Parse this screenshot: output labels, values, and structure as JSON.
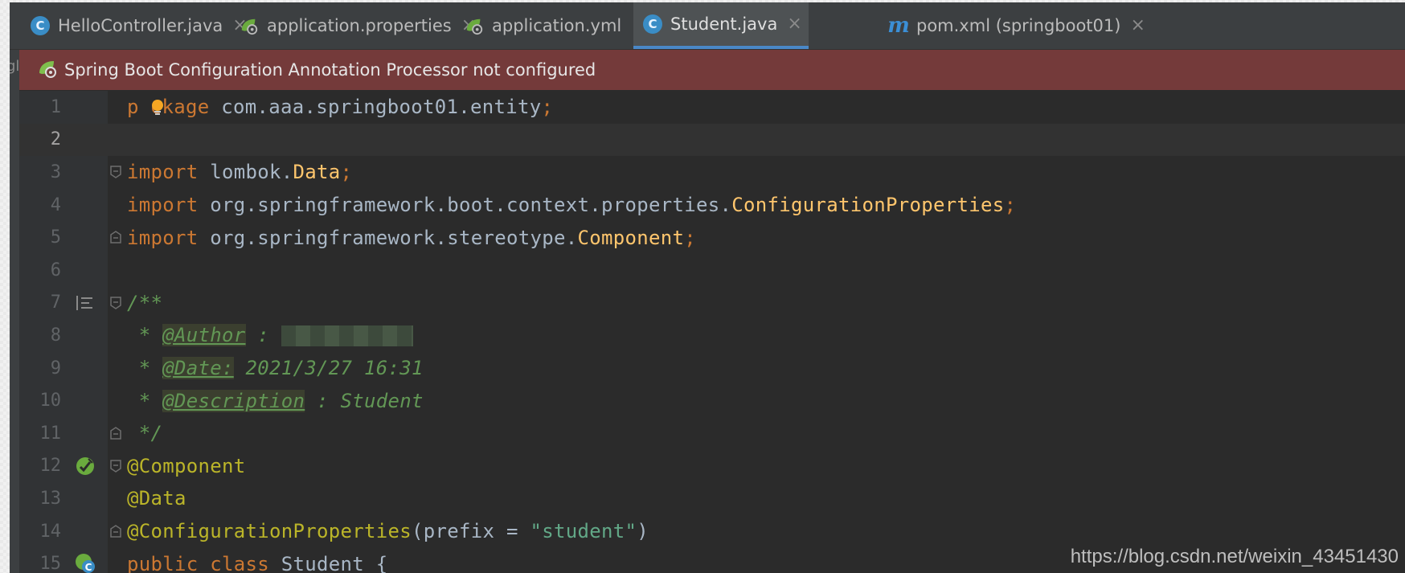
{
  "tabs": [
    {
      "label": "HelloController.java",
      "icon": "java-class-icon",
      "active": false
    },
    {
      "label": "application.properties",
      "icon": "spring-config-icon",
      "active": false
    },
    {
      "label": "application.yml",
      "icon": "spring-config-icon",
      "active": false
    },
    {
      "label": "Student.java",
      "icon": "java-class-icon",
      "active": true
    },
    {
      "label": "pom.xml (springboot01)",
      "icon": "maven-icon",
      "active": false
    }
  ],
  "tab_close_glyph": "×",
  "class_icon_letter": "C",
  "maven_icon_letter": "m",
  "banner": {
    "text": "Spring Boot Configuration Annotation Processor not configured"
  },
  "left_strip_text": "gl",
  "editor": {
    "current_line": 2,
    "line_numbers": [
      "1",
      "2",
      "3",
      "4",
      "5",
      "6",
      "7",
      "8",
      "9",
      "10",
      "11",
      "12",
      "13",
      "14",
      "15"
    ],
    "code": {
      "l1_kw_a": "p",
      "l1_kw_b": "ckage",
      "l1_pkg": " com.aaa.springboot01.entity",
      "semicolon": ";",
      "import_kw": "import",
      "l3_pkg": " lombok.",
      "l3_cls": "Data",
      "l4_pkg": " org.springframework.boot.context.properties.",
      "l4_cls": "ConfigurationProperties",
      "l5_pkg": " org.springframework.stereotype.",
      "l5_cls": "Component",
      "l7_doc": "/**",
      "doc_star": " * ",
      "author_tag": "@Author",
      "author_sep": " : ",
      "date_tag": "@Date:",
      "date_val": " 2021/3/27 16:31",
      "desc_tag": "@Description",
      "desc_val": " : Student",
      "l11_doc": " */",
      "l12_anno": "@Component",
      "l13_anno": "@Data",
      "l14_anno": "@ConfigurationProperties",
      "l14_open": "(",
      "l14_attr": "prefix",
      "l14_eq": " = ",
      "l14_str": "\"student\"",
      "l14_close": ")",
      "l15_kw": "public class",
      "l15_name": " Student {"
    }
  },
  "watermark": "https://blog.csdn.net/weixin_43451430"
}
